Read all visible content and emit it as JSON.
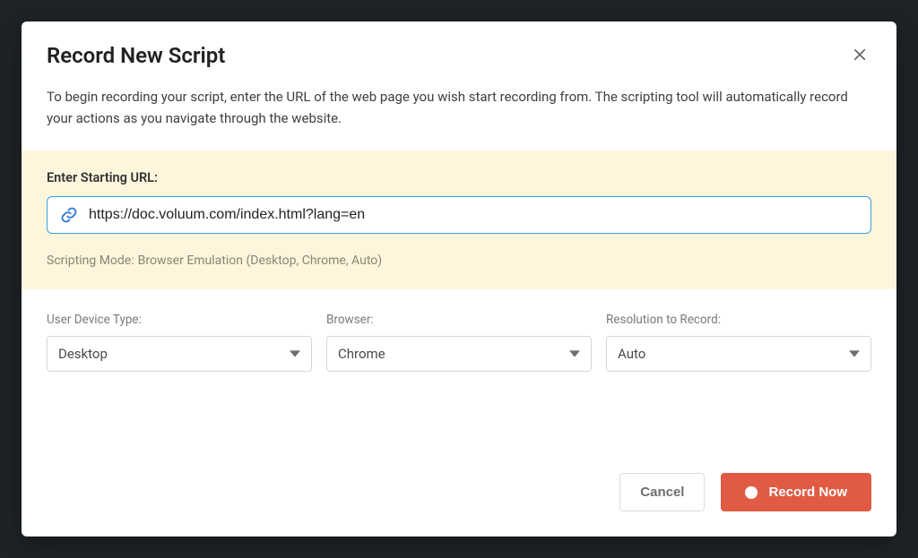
{
  "modal": {
    "title": "Record New Script",
    "description": "To begin recording your script, enter the URL of the web page you wish start recording from. The scripting tool will automatically record your actions as you navigate through the website."
  },
  "url_section": {
    "label": "Enter Starting URL:",
    "value": "https://doc.voluum.com/index.html?lang=en",
    "scripting_mode_label": "Scripting Mode:",
    "scripting_mode_value": "Browser Emulation (Desktop, Chrome, Auto)"
  },
  "selects": {
    "device_type": {
      "label": "User Device Type:",
      "value": "Desktop"
    },
    "browser": {
      "label": "Browser:",
      "value": "Chrome"
    },
    "resolution": {
      "label": "Resolution to Record:",
      "value": "Auto"
    }
  },
  "footer": {
    "cancel": "Cancel",
    "record": "Record Now"
  },
  "colors": {
    "primary_button": "#e15b44",
    "input_border_focus": "#3a9fe2",
    "url_panel_bg": "#fdf5dc"
  }
}
